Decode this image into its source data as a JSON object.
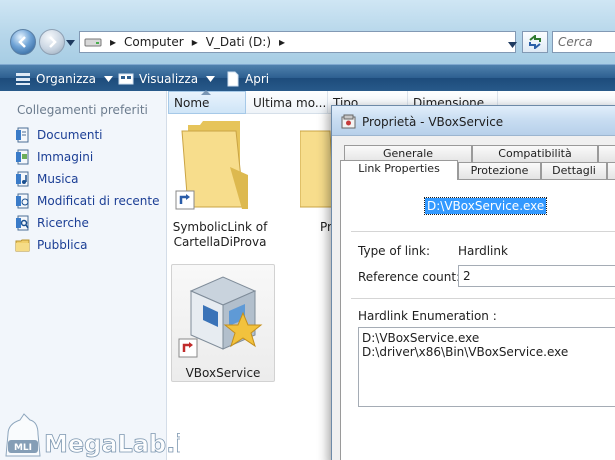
{
  "address_bar": {
    "segments": [
      "Computer",
      "V_Dati (D:)"
    ],
    "search_placeholder": "Cerca"
  },
  "command_bar": {
    "organize_label": "Organizza",
    "view_label": "Visualizza",
    "open_label": "Apri"
  },
  "navigation_pane": {
    "title": "Collegamenti preferiti",
    "items": [
      {
        "label": "Documenti",
        "icon": "documents-icon"
      },
      {
        "label": "Immagini",
        "icon": "pictures-icon"
      },
      {
        "label": "Musica",
        "icon": "music-icon"
      },
      {
        "label": "Modificati di recente",
        "icon": "recent-icon"
      },
      {
        "label": "Ricerche",
        "icon": "searches-icon"
      },
      {
        "label": "Pubblica",
        "icon": "public-folder-icon"
      }
    ]
  },
  "columns": [
    "Nome",
    "Ultima mo...",
    "Tipo",
    "Dimensione"
  ],
  "files": [
    {
      "label_line1": "SymbolicLink of",
      "label_line2": "CartellaDiProva"
    },
    {
      "label_line1": "Pr",
      "label_line2": ""
    },
    {
      "label_line1": "VBoxService",
      "label_line2": ""
    }
  ],
  "dialog": {
    "title": "Proprietà - VBoxService",
    "tabs_row1": [
      "Generale",
      "Compatibilità"
    ],
    "tabs_row2": [
      "Link Properties",
      "Protezione",
      "Dettagli"
    ],
    "path_value": "D:\\VBoxService.exe",
    "type_label": "Type of link:",
    "type_value": "Hardlink",
    "refcount_label": "Reference count:",
    "refcount_value": "2",
    "enum_label": "Hardlink Enumeration :",
    "enum_lines": [
      "D:\\VBoxService.exe",
      "D:\\driver\\x86\\Bin\\VBoxService.exe"
    ]
  },
  "watermark": {
    "text": "MegaLab.it",
    "logo_text": "MLI"
  },
  "colors": {
    "accent": "#3399ff",
    "nav_link": "#1c3f95",
    "command_bar": "#2d5f90"
  }
}
